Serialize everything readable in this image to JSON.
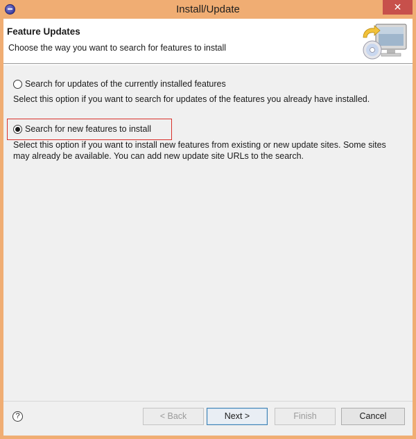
{
  "window": {
    "title": "Install/Update",
    "close_glyph": "✕",
    "app_icon": "eclipse-icon"
  },
  "header": {
    "title": "Feature Updates",
    "description": "Choose the way you want to search for features to install",
    "icon": "install-monitor-cd-icon"
  },
  "options": [
    {
      "label": "Search for updates of the currently installed features",
      "description": "Select this option if you want to search for updates of the features you already have installed.",
      "selected": false
    },
    {
      "label": "Search for new features to install",
      "description": "Select this option if you want to install new features from existing or new update sites. Some sites may already be available. You can add new update site URLs to the search.",
      "selected": true
    }
  ],
  "footer": {
    "help_glyph": "?",
    "back_label": "< Back",
    "next_label": "Next >",
    "finish_label": "Finish",
    "cancel_label": "Cancel"
  },
  "colors": {
    "titlebar": "#f0ad73",
    "highlight_box": "#d9302a",
    "close_button": "#c7504b"
  }
}
